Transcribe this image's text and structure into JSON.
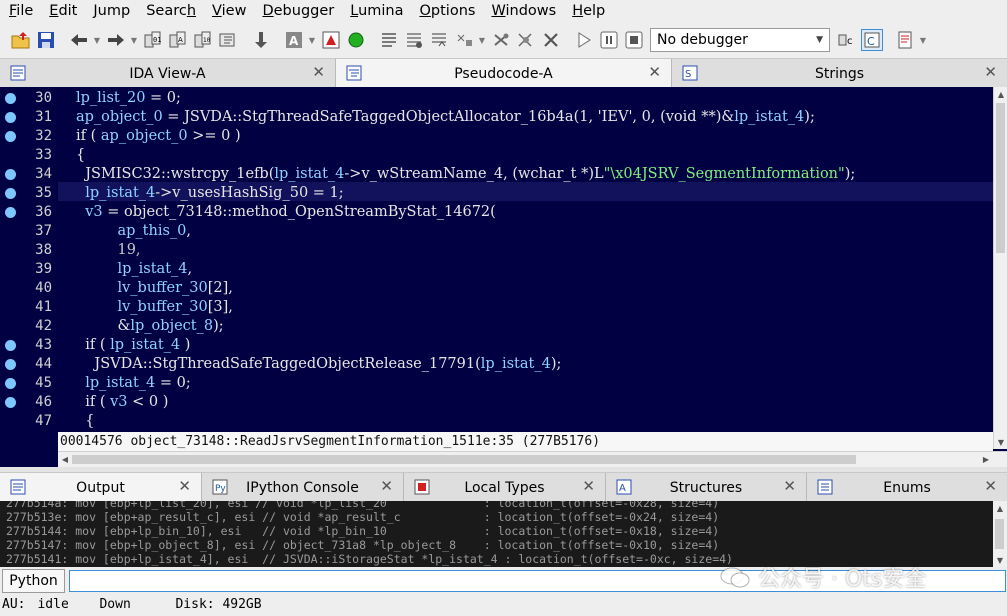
{
  "menubar": {
    "items": [
      {
        "pre": "",
        "ul": "F",
        "post": "ile"
      },
      {
        "pre": "",
        "ul": "E",
        "post": "dit"
      },
      {
        "pre": "",
        "ul": "J",
        "post": "ump"
      },
      {
        "pre": "Searc",
        "ul": "h",
        "post": ""
      },
      {
        "pre": "",
        "ul": "V",
        "post": "iew"
      },
      {
        "pre": "",
        "ul": "D",
        "post": "ebugger"
      },
      {
        "pre": "",
        "ul": "L",
        "post": "umina"
      },
      {
        "pre": "",
        "ul": "O",
        "post": "ptions"
      },
      {
        "pre": "",
        "ul": "W",
        "post": "indows"
      },
      {
        "pre": "",
        "ul": "H",
        "post": "elp"
      }
    ]
  },
  "toolbar": {
    "debugger_select": "No debugger"
  },
  "tabs": [
    {
      "label": "IDA View-A",
      "icon": "disasm-view-icon",
      "active": false
    },
    {
      "label": "Pseudocode-A",
      "icon": "pseudocode-icon",
      "active": true
    },
    {
      "label": "Strings",
      "icon": "strings-icon",
      "active": false
    }
  ],
  "editor": {
    "lines": [
      {
        "num": "30",
        "bp": true,
        "hl": false
      },
      {
        "num": "31",
        "bp": true,
        "hl": false
      },
      {
        "num": "32",
        "bp": true,
        "hl": false
      },
      {
        "num": "33",
        "bp": false,
        "hl": false
      },
      {
        "num": "34",
        "bp": true,
        "hl": false
      },
      {
        "num": "35",
        "bp": true,
        "hl": true
      },
      {
        "num": "36",
        "bp": true,
        "hl": false
      },
      {
        "num": "37",
        "bp": false,
        "hl": false
      },
      {
        "num": "38",
        "bp": false,
        "hl": false
      },
      {
        "num": "39",
        "bp": false,
        "hl": false
      },
      {
        "num": "40",
        "bp": false,
        "hl": false
      },
      {
        "num": "41",
        "bp": false,
        "hl": false
      },
      {
        "num": "42",
        "bp": false,
        "hl": false
      },
      {
        "num": "43",
        "bp": true,
        "hl": false
      },
      {
        "num": "44",
        "bp": true,
        "hl": false
      },
      {
        "num": "45",
        "bp": true,
        "hl": false
      },
      {
        "num": "46",
        "bp": true,
        "hl": false
      },
      {
        "num": "47",
        "bp": false,
        "hl": false
      }
    ],
    "code": {
      "l30": {
        "a": "lp_list_20",
        "b": " = 0;"
      },
      "l31": {
        "a": "ap_object_0",
        "b": " = JSVDA::StgThreadSafeTaggedObjectAllocator_16b4a(1, 'IEV', 0, (void **)&",
        "c": "lp_istat_4",
        "d": ");"
      },
      "l32": {
        "a": "if ( ",
        "b": "ap_object_0",
        "c": " >= 0 )"
      },
      "l33": {
        "a": "{"
      },
      "l34": {
        "a": "  JSMISC32::wstrcpy_1efb(",
        "b": "lp_istat_4",
        "c": "->v_wStreamName_4, (wchar_t *)L",
        "d": "\"\\x04JSRV_SegmentInformation\"",
        "e": ");"
      },
      "l35": {
        "a": "  lp_istat_4",
        "b": "->v_usesHashSig_50 = 1;"
      },
      "l36": {
        "a": "  v3",
        "b": " = object_73148::method_OpenStreamByStat_14672("
      },
      "l37": {
        "a": "         ap_this_0",
        "b": ","
      },
      "l38": {
        "a": "         19,"
      },
      "l39": {
        "a": "         lp_istat_4",
        "b": ","
      },
      "l40": {
        "a": "         lv_buffer_30",
        "b": "[2],"
      },
      "l41": {
        "a": "         lv_buffer_30",
        "b": "[3],"
      },
      "l42": {
        "a": "         &",
        "b": "lp_object_8",
        "c": ");"
      },
      "l43": {
        "a": "  if ( ",
        "b": "lp_istat_4",
        "c": " )"
      },
      "l44": {
        "a": "    JSVDA::StgThreadSafeTaggedObjectRelease_17791(",
        "b": "lp_istat_4",
        "c": ");"
      },
      "l45": {
        "a": "  lp_istat_4",
        "b": " = 0;"
      },
      "l46": {
        "a": "  if ( ",
        "b": "v3",
        "c": " < 0 )"
      },
      "l47": {
        "a": "  {"
      }
    },
    "status_line": "00014576 object_73148::ReadJsrvSegmentInformation_1511e:35 (277B5176)"
  },
  "bottom_tabs": [
    {
      "label": "Output",
      "icon": "output-icon",
      "active": true
    },
    {
      "label": "IPython Console",
      "icon": "python-console-icon",
      "active": false
    },
    {
      "label": "Local Types",
      "icon": "local-types-icon",
      "active": false
    },
    {
      "label": "Structures",
      "icon": "structures-icon",
      "active": false
    },
    {
      "label": "Enums",
      "icon": "enums-icon",
      "active": false
    }
  ],
  "output": {
    "lines": [
      "277b514a: mov [ebp+lp_list_20], esi // void *lp_list_20              : location_t(offset=-0x28, size=4)",
      "277b513e: mov [ebp+ap_result_c], esi // void *ap_result_c            : location_t(offset=-0x24, size=4)",
      "277b5144: mov [ebp+lp_bin_10], esi   // void *lp_bin_10              : location_t(offset=-0x18, size=4)",
      "277b5147: mov [ebp+lp_object_8], esi // object_731a8 *lp_object_8    : location_t(offset=-0x10, size=4)",
      "277b5141: mov [ebp+lp_istat_4], esi  // JSVDA::iStorageStat *lp_istat_4 : location_t(offset=-0xc, size=4)"
    ]
  },
  "cmdbar": {
    "language": "Python",
    "input_value": ""
  },
  "statusbar": {
    "au_label": "AU:",
    "au_state": "idle",
    "direction": "Down",
    "disk": "Disk: 492GB"
  },
  "watermark": {
    "text": "公众号 · Ots安全"
  },
  "colors": {
    "editor_bg": "#000042",
    "variable": "#8fd3ff",
    "string": "#7ef07e",
    "breakpoint": "#7ec8ff"
  }
}
